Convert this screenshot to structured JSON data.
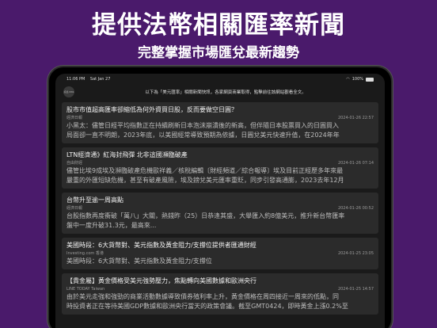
{
  "promo": {
    "title": "提供法幣相關匯率新聞",
    "subtitle": "完整掌握市場匯兌最新趨勢"
  },
  "status_bar": {
    "time": "11:06 PM",
    "date": "Sat Jan 27",
    "battery": "100%"
  },
  "notice": {
    "avatar_text": "訊息 RSS",
    "text": "以下為「美元匯率」相關新聞快訊，各家網頁商業取得，點擊前往該網站觀看全文。"
  },
  "articles": [
    {
      "title": "股市市值超高匯率卻縮低為何外資買日股，反而要做空日圓？",
      "source": "經濟日報",
      "date": "2024-01-26 22:57",
      "body": [
        "小黑太：儘管日經平均指數正在持續刷新日本泡沫崩潰後的新高，但伴隨日本股票買入的日圓買入",
        "局面卻一直不明朗，2023年底，以美國經常導致預期為依據，日圓兌美元快速升值，在2024年年"
      ]
    },
    {
      "title": "LTN經濟通》紅海封飛彈 北非這國瀕臨破產",
      "source": "自由財經",
      "date": "2024-01-26 07:14",
      "body": [
        "儘管比埃9成埃及瀕臨破產危機歐祥義／核稅編輯〔財經頻道／綜合報導〕埃及目前正經歷多年來最",
        "嚴重的外匯短缺危機，甚至有破產風險，埃及鎊兌美元匯率重貶，同步引發高通膨，2023去年12月"
      ]
    },
    {
      "title": "台幣升至逾一周高點",
      "source": "經濟日報",
      "date": "2024-01-26 00:52",
      "body": [
        "台股指數再度衝破「萬八」大關，熱錢昨（25）日恭逢其盛，大舉匯入約8億美元，推升新台幣匯率",
        "盤中一度升破31.3元，最高來..."
      ]
    },
    {
      "title": "美國時段：6大貨幣對、美元指數及黃金阻力/支撐位提供者匯通財經",
      "source": "Investing.com 香港",
      "date": "2024-01-25 23:05",
      "body": [
        "美國時段：6大貨幣對、美元指數及黃金阻力/支撐位"
      ]
    },
    {
      "title": "【貴金屬】黃金價格受美元強勢壓力，焦點轉向美國數據和歐洲央行",
      "source": "LINE TODAY Taiwan",
      "date": "2024-01-25 14:57",
      "body": [
        "由於美元走強和強勁的商業活動數據導致債券殖利率上升，黃金價格在周四接近一周來的低點，同",
        "時投資者正在等待美國GDP數據和歐洲央行當天的政策會議。截至GMT0424，即時黃金上漲0.2%至"
      ]
    }
  ]
}
